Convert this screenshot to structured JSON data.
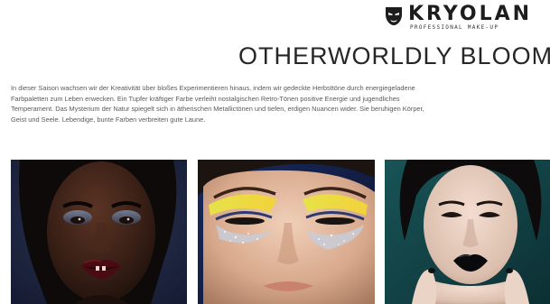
{
  "brand": {
    "name": "KRYOLAN",
    "tagline": "PROFESSIONAL MAKE-UP"
  },
  "page": {
    "title": "OTHERWORLDLY BLOOM"
  },
  "intro": {
    "lines": [
      "In dieser Saison wachsen wir der Kreativität über bloßes Experimentieren hinaus, indem wir gedeckte Herbsttöne durch energiegeladene",
      "Farbpaletten zum Leben erwecken. Ein Tupfer kräftiger Farbe verleiht nostalgischen Retro-Tönen positive Energie und jugendliches",
      "Temperament. Das Mysterium der Natur spiegelt sich in ätherischen Metallictönen und tiefen, erdigen Nuancen wider. Sie beruhigen Körper,",
      "Geist und Seele. Lebendige, bunte Farben verbreiten gute Laune."
    ]
  },
  "gallery": {
    "images": [
      {
        "subject": "portrait-dark-red-lips",
        "background": "#1d2440"
      },
      {
        "subject": "portrait-yellow-glitter-eyes",
        "background": "#0f1d44"
      },
      {
        "subject": "portrait-black-lips",
        "background": "#113e41"
      }
    ]
  }
}
